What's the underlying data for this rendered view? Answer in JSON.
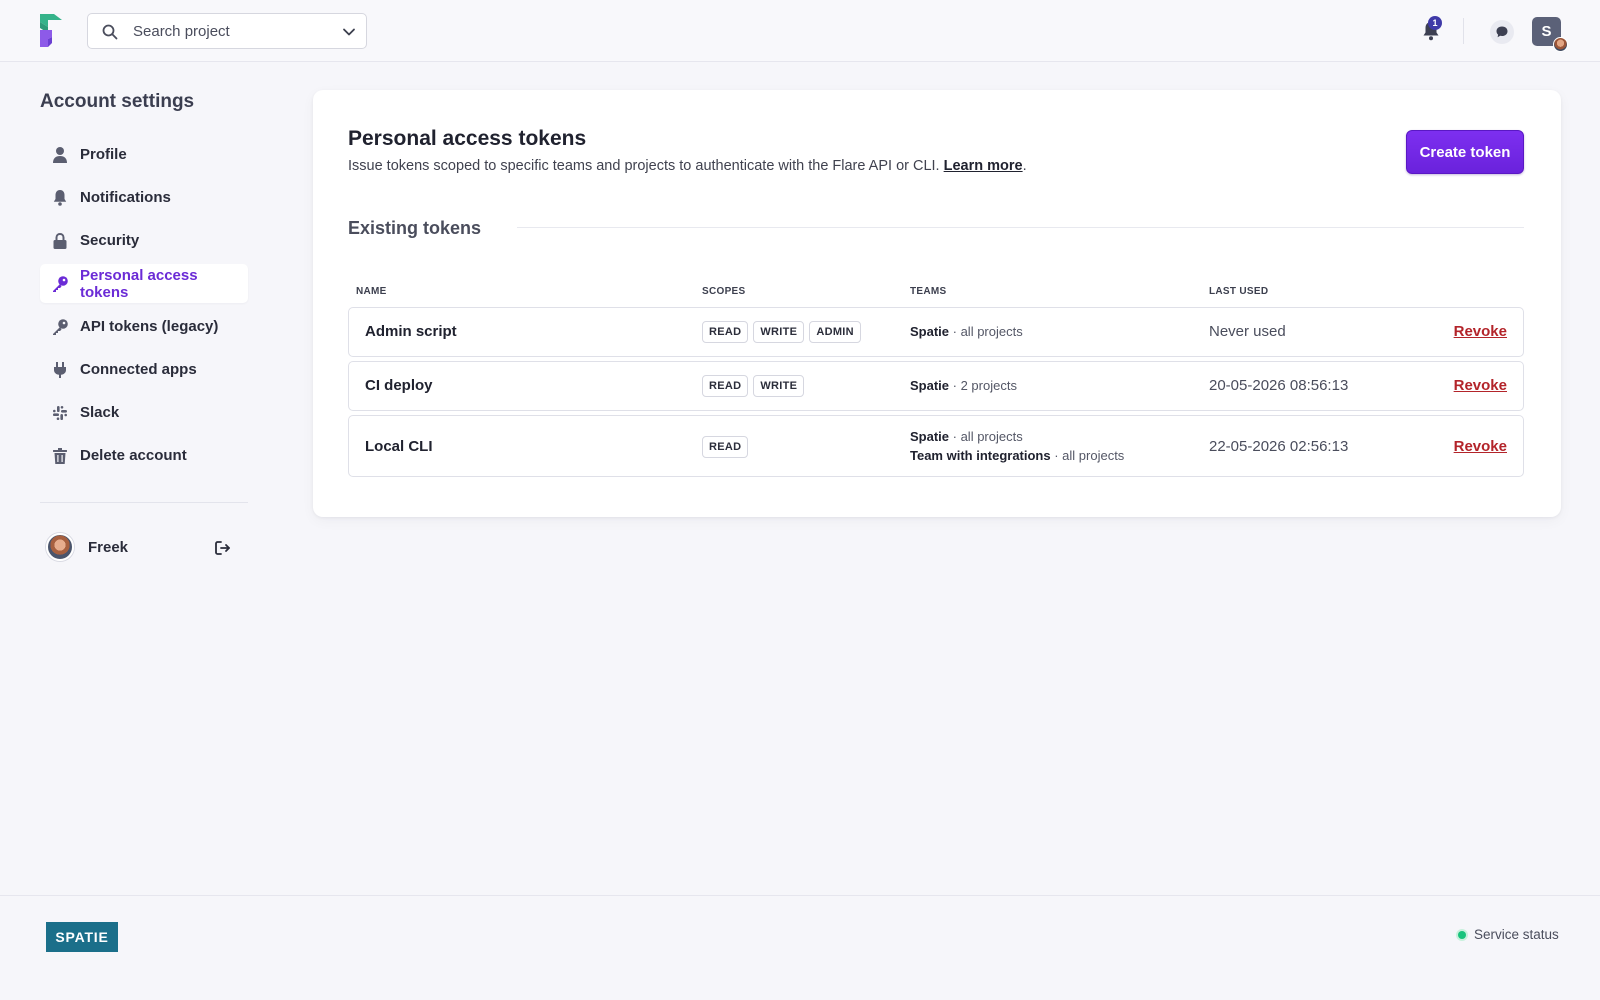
{
  "topbar": {
    "search_placeholder": "Search project",
    "notifications_count": "1",
    "team_initial": "S"
  },
  "sidebar": {
    "title": "Account settings",
    "items": [
      {
        "label": "Profile",
        "icon": "user-icon",
        "active": false
      },
      {
        "label": "Notifications",
        "icon": "bell-icon",
        "active": false
      },
      {
        "label": "Security",
        "icon": "lock-icon",
        "active": false
      },
      {
        "label": "Personal access tokens",
        "icon": "key-icon",
        "active": true
      },
      {
        "label": "API tokens (legacy)",
        "icon": "key-icon",
        "active": false
      },
      {
        "label": "Connected apps",
        "icon": "plug-icon",
        "active": false
      },
      {
        "label": "Slack",
        "icon": "slack-icon",
        "active": false
      },
      {
        "label": "Delete account",
        "icon": "trash-icon",
        "active": false
      }
    ],
    "user_name": "Freek"
  },
  "main": {
    "title": "Personal access tokens",
    "description": "Issue tokens scoped to specific teams and projects to authenticate with the Flare API or CLI.",
    "learn_more": "Learn more",
    "description_end": ".",
    "create_button": "Create token",
    "section_title": "Existing tokens",
    "columns": {
      "name": "NAME",
      "scopes": "SCOPES",
      "teams": "TEAMS",
      "last_used": "LAST USED"
    },
    "tokens": [
      {
        "name": "Admin script",
        "scopes": [
          "READ",
          "WRITE",
          "ADMIN"
        ],
        "teams": [
          {
            "team": "Spatie",
            "projects": "all projects"
          }
        ],
        "last_used": "Never used",
        "revoke": "Revoke"
      },
      {
        "name": "CI deploy",
        "scopes": [
          "READ",
          "WRITE"
        ],
        "teams": [
          {
            "team": "Spatie",
            "projects": "2 projects"
          }
        ],
        "last_used": "20-05-2026 08:56:13",
        "revoke": "Revoke"
      },
      {
        "name": "Local CLI",
        "scopes": [
          "READ"
        ],
        "teams": [
          {
            "team": "Spatie",
            "projects": "all projects"
          },
          {
            "team": "Team with integrations",
            "projects": "all projects"
          }
        ],
        "last_used": "22-05-2026 02:56:13",
        "revoke": "Revoke"
      }
    ]
  },
  "footer": {
    "brand": "SPATIE",
    "service_status": "Service status"
  },
  "colors": {
    "accent": "#6b2bd6",
    "danger": "#b3242a",
    "status_ok": "#19c37d",
    "brand_footer": "#1b6f8a"
  }
}
